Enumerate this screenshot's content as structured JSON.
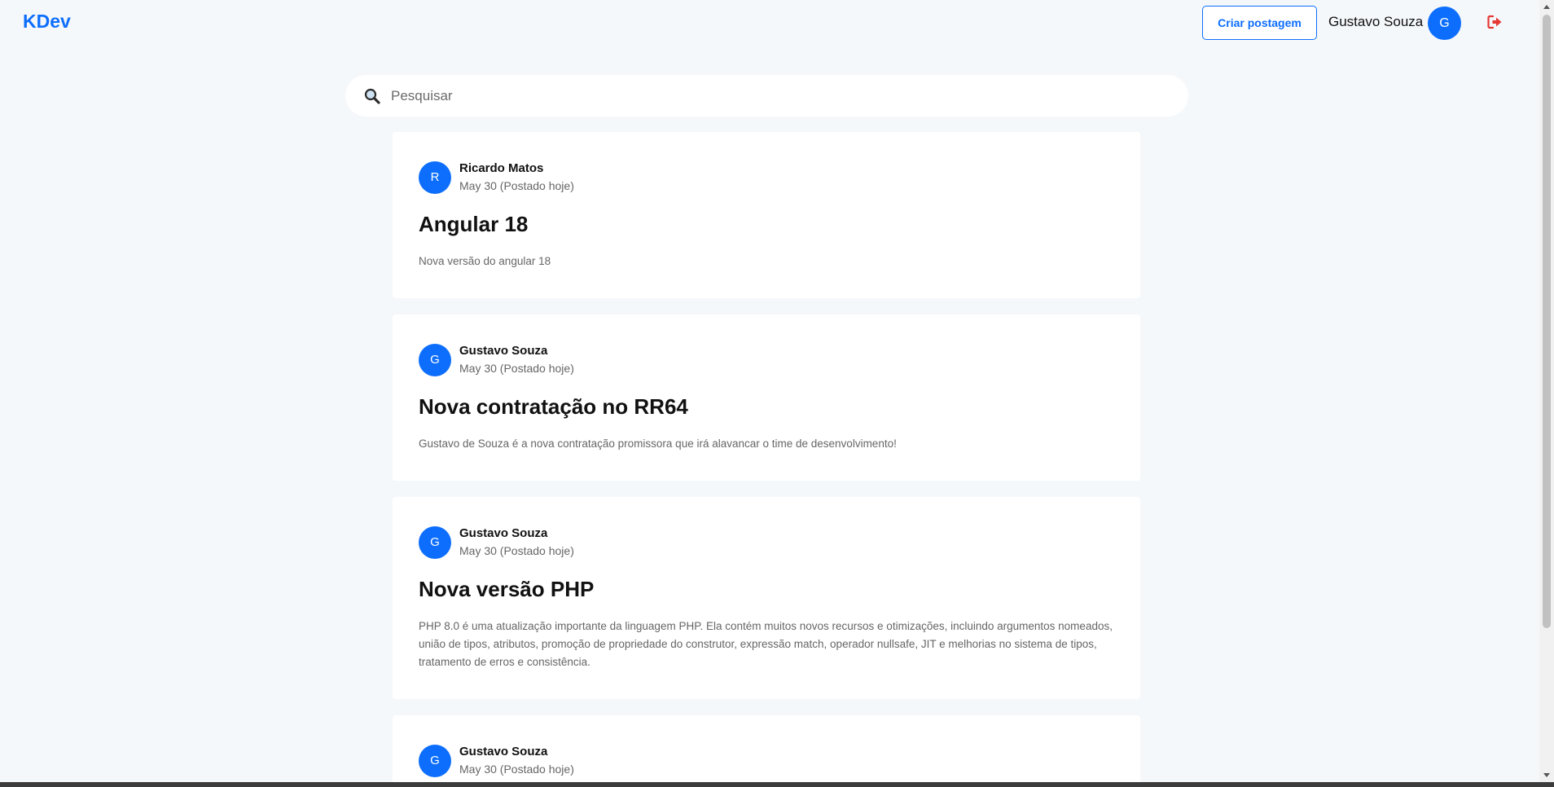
{
  "header": {
    "logo": "KDev",
    "create_button": "Criar postagem",
    "user_name": "Gustavo Souza",
    "user_initial": "G",
    "logout_icon": "sign-out-icon"
  },
  "search": {
    "placeholder": "Pesquisar",
    "value": "",
    "icon": "magnifier-icon"
  },
  "colors": {
    "accent": "#0d6efd",
    "logout": "#e53935",
    "background": "#f5f8fb"
  },
  "posts": [
    {
      "initial": "R",
      "author": "Ricardo Matos",
      "date": "May 30 (Postado hoje)",
      "title": "Angular 18",
      "body": "Nova versão do angular 18"
    },
    {
      "initial": "G",
      "author": "Gustavo Souza",
      "date": "May 30 (Postado hoje)",
      "title": "Nova contratação no RR64",
      "body": "Gustavo de Souza é a nova contratação promissora que irá alavancar o time de desenvolvimento!"
    },
    {
      "initial": "G",
      "author": "Gustavo Souza",
      "date": "May 30 (Postado hoje)",
      "title": "Nova versão PHP",
      "body": "PHP 8.0 é uma atualização importante da linguagem PHP. Ela contém muitos novos recursos e otimizações, incluindo argumentos nomeados, união de tipos, atributos, promoção de propriedade do construtor, expressão match, operador nullsafe, JIT e melhorias no sistema de tipos, tratamento de erros e consistência."
    },
    {
      "initial": "G",
      "author": "Gustavo Souza",
      "date": "May 30 (Postado hoje)"
    }
  ]
}
